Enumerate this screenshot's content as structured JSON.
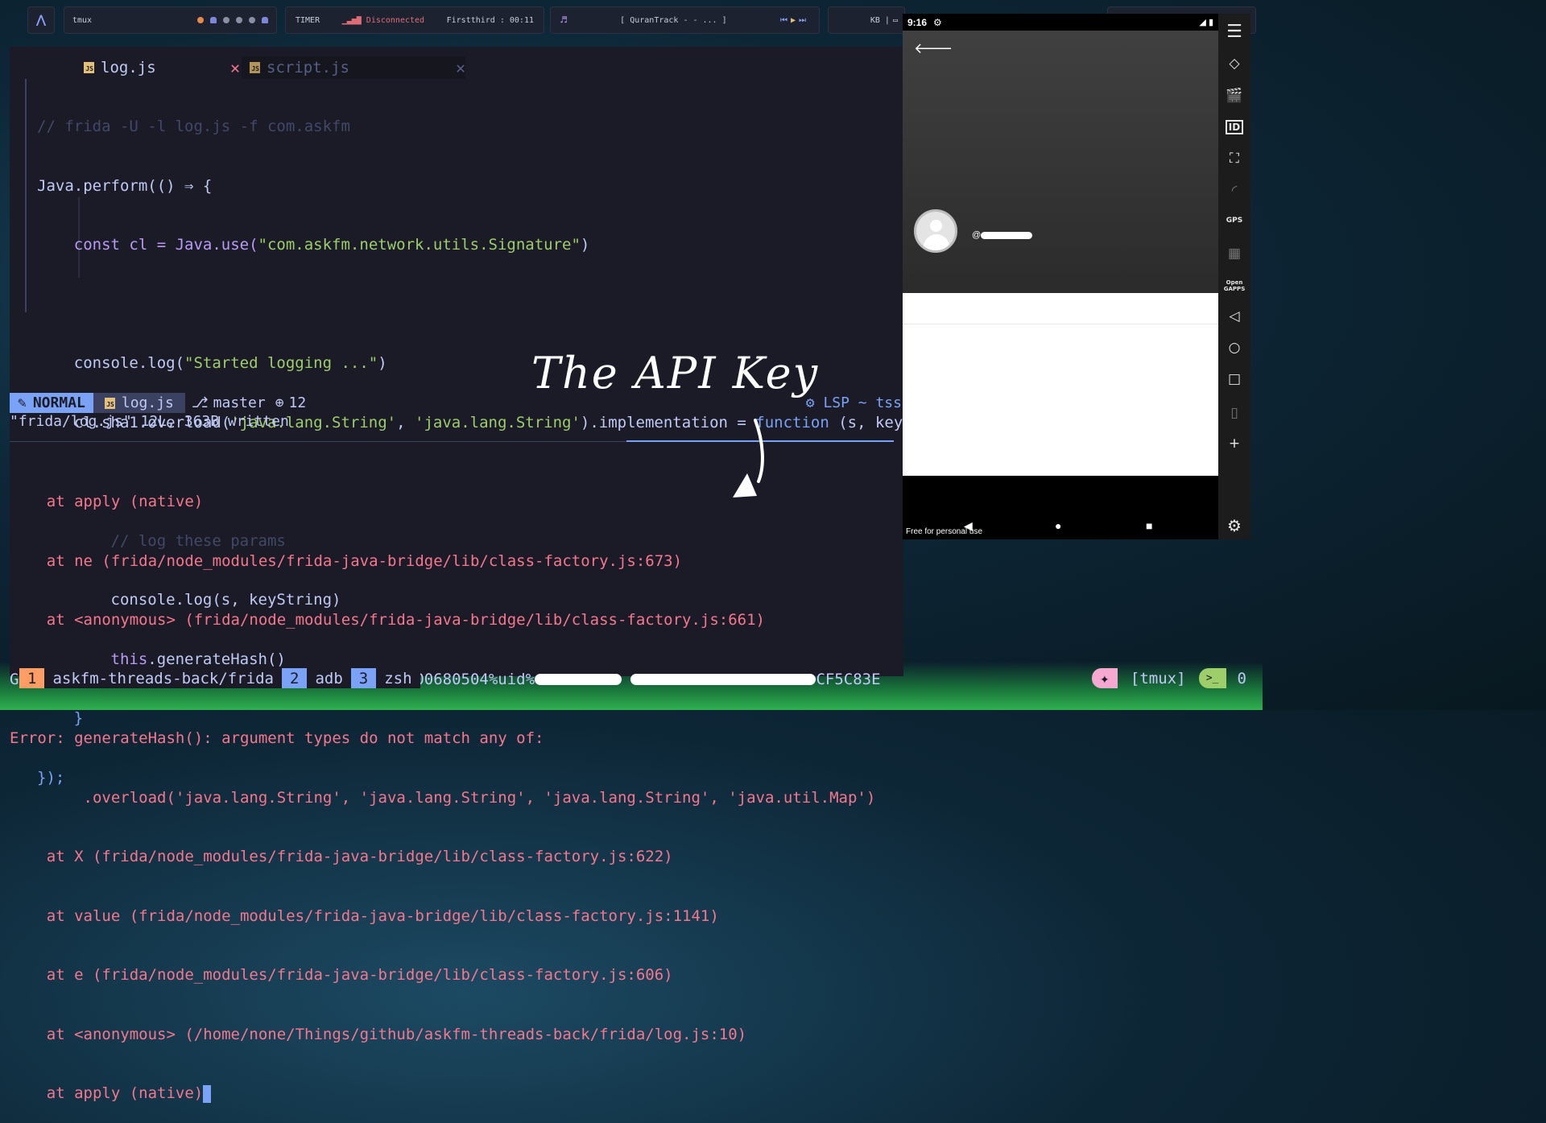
{
  "topbar": {
    "tmux_label": "tmux",
    "timer_label": "TIMER",
    "network_status": "Disconnected",
    "firstthird": "Firstthird : 00:11",
    "track": "[ QuranTrack -  - ... ]",
    "kb_label": "KB |"
  },
  "editor": {
    "tabs": [
      {
        "label": "log.js",
        "icon": "JS"
      },
      {
        "label": "script.js",
        "icon": "JS"
      }
    ],
    "close_glyph": "✕",
    "code": {
      "l1": "// frida -U -l log.js -f com.askfm",
      "l2a": "Java.perform(() ⇒ {",
      "l3a": "    const cl = Java.use(",
      "l3b": "\"com.askfm.network.utils.Signature\"",
      "l3c": ")",
      "l5a": "    console.log(",
      "l5b": "\"Started logging ...\"",
      "l5c": ")",
      "l6a": "    cl.sha1.overload(",
      "l6b": "'java.lang.String'",
      "l6c": ", ",
      "l6d": "'java.lang.String'",
      "l6e": ").implementation = ",
      "l6f": "function",
      "l6g": " (s, key",
      "l8": "        // log these params",
      "l9": "        console.log(s, keyString)",
      "l10a": "        this",
      "l10b": ".generateHash()",
      "l11": "    }",
      "l12": "});"
    },
    "status": {
      "mode": "NORMAL",
      "file": "log.js",
      "branch": "master",
      "changes": "12",
      "lsp": "LSP ~ tss"
    },
    "message": "\"frida/log.js\" 12L, 363B written"
  },
  "terminal": {
    "lines": [
      "    at apply (native)",
      "    at ne (frida/node_modules/frida-java-bridge/lib/class-factory.js:673)",
      "    at <anonymous> (frida/node_modules/frida-java-bridge/lib/class-factory.js:661)"
    ],
    "get_prefix": "GET%api.ask.fm:443%/users/details%rt%1%ts%1700680504%uid%",
    "get_suffix": "CF5C83E",
    "error_lines": [
      "Error: generateHash(): argument types do not match any of:",
      "        .overload('java.lang.String', 'java.lang.String', 'java.lang.String', 'java.util.Map')",
      "    at X (frida/node_modules/frida-java-bridge/lib/class-factory.js:622)",
      "    at value (frida/node_modules/frida-java-bridge/lib/class-factory.js:1141)",
      "    at e (frida/node_modules/frida-java-bridge/lib/class-factory.js:606)",
      "    at <anonymous> (/home/none/Things/github/askfm-threads-back/frida/log.js:10)",
      "    at apply (native)"
    ]
  },
  "annotation": {
    "text": "The API Key"
  },
  "tmux": {
    "windows": [
      {
        "num": "1",
        "name": "askfm-threads-back/frida"
      },
      {
        "num": "2",
        "name": "adb"
      },
      {
        "num": "3",
        "name": "zsh"
      }
    ],
    "session": "[tmux]",
    "count": "0"
  },
  "phone": {
    "time": "9:16",
    "handle_prefix": "@",
    "watermark": "Free for personal use"
  },
  "emulator_sidebar": {
    "gps_label": "GPS",
    "opengapps_label": "Open GAPPS",
    "id_label": "ID"
  },
  "colors": {
    "accent_blue": "#7aa2f7",
    "error_red": "#f7768e",
    "string_green": "#9ece6a",
    "keyword_purple": "#bb9af7",
    "editor_bg": "#1a1b26"
  }
}
